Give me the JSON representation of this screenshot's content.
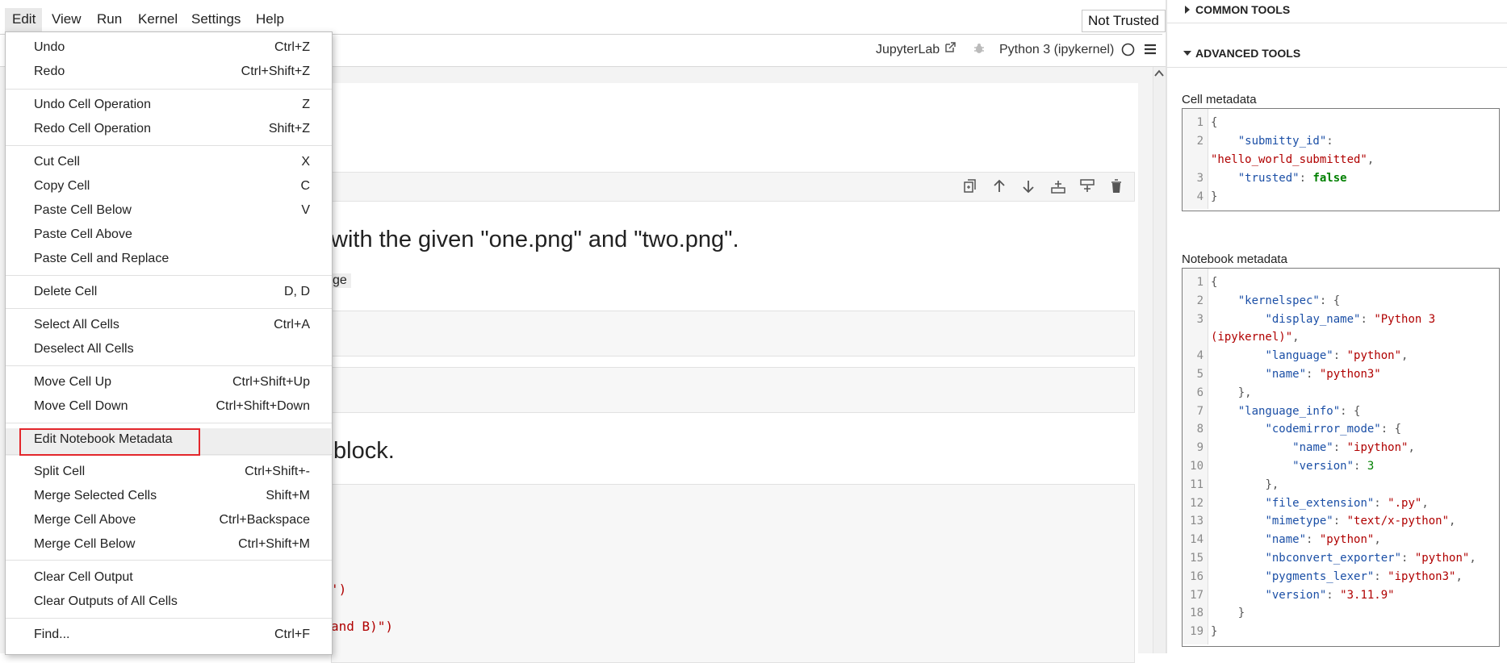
{
  "menubar": {
    "items": [
      "Edit",
      "View",
      "Run",
      "Kernel",
      "Settings",
      "Help"
    ],
    "not_trusted": "Not Trusted"
  },
  "toolbar": {
    "jupyterlab": "JupyterLab",
    "kernel": "Python 3 (ipykernel)"
  },
  "notebook": {
    "md_line1": "with the given \"one.png\" and \"two.png\".",
    "md_snippet": "ge",
    "md_line2": "block.",
    "code_frag1": "')",
    "code_frag2": "and B)\")"
  },
  "edit_menu": {
    "items": [
      {
        "label": "Undo",
        "shortcut": "Ctrl+Z"
      },
      {
        "label": "Redo",
        "shortcut": "Ctrl+Shift+Z"
      },
      {
        "label": "Undo Cell Operation",
        "shortcut": "Z"
      },
      {
        "label": "Redo Cell Operation",
        "shortcut": "Shift+Z"
      },
      {
        "label": "Cut Cell",
        "shortcut": "X"
      },
      {
        "label": "Copy Cell",
        "shortcut": "C"
      },
      {
        "label": "Paste Cell Below",
        "shortcut": "V"
      },
      {
        "label": "Paste Cell Above",
        "shortcut": ""
      },
      {
        "label": "Paste Cell and Replace",
        "shortcut": ""
      },
      {
        "label": "Delete Cell",
        "shortcut": "D, D"
      },
      {
        "label": "Select All Cells",
        "shortcut": "Ctrl+A"
      },
      {
        "label": "Deselect All Cells",
        "shortcut": ""
      },
      {
        "label": "Move Cell Up",
        "shortcut": "Ctrl+Shift+Up"
      },
      {
        "label": "Move Cell Down",
        "shortcut": "Ctrl+Shift+Down"
      },
      {
        "label": "Edit Notebook Metadata",
        "shortcut": ""
      },
      {
        "label": "Split Cell",
        "shortcut": "Ctrl+Shift+-"
      },
      {
        "label": "Merge Selected Cells",
        "shortcut": "Shift+M"
      },
      {
        "label": "Merge Cell Above",
        "shortcut": "Ctrl+Backspace"
      },
      {
        "label": "Merge Cell Below",
        "shortcut": "Ctrl+Shift+M"
      },
      {
        "label": "Clear Cell Output",
        "shortcut": ""
      },
      {
        "label": "Clear Outputs of All Cells",
        "shortcut": ""
      },
      {
        "label": "Find...",
        "shortcut": "Ctrl+F"
      }
    ]
  },
  "sidebar": {
    "common_tools": "COMMON TOOLS",
    "advanced_tools": "ADVANCED TOOLS",
    "cell_metadata_label": "Cell metadata",
    "notebook_metadata_label": "Notebook metadata",
    "cell_lines": [
      "1",
      "2",
      "3",
      "4"
    ],
    "cell_code": {
      "l1": "{",
      "l2_key": "\"submitty_id\"",
      "l2_colon": ":",
      "l2b_val": "\"hello_world_submitted\"",
      "l2b_comma": ",",
      "l3_key": "\"trusted\"",
      "l3_colon": ": ",
      "l3_val": "false",
      "l4": "}"
    },
    "nb_lines": [
      "1",
      "2",
      "3",
      "4",
      "5",
      "6",
      "7",
      "8",
      "9",
      "10",
      "11",
      "12",
      "13",
      "14",
      "15",
      "16",
      "17",
      "18",
      "19"
    ],
    "nb_code": {
      "r1": "{",
      "r2k": "\"kernelspec\"",
      "r2p": ": {",
      "r3k": "\"display_name\"",
      "r3p": ": ",
      "r3v": "\"Python 3",
      "r3b": "(ipykernel)\"",
      "r3bp": ",",
      "r4k": "\"language\"",
      "r4p": ": ",
      "r4v": "\"python\"",
      "r4c": ",",
      "r5k": "\"name\"",
      "r5p": ": ",
      "r5v": "\"python3\"",
      "r6": "},",
      "r7k": "\"language_info\"",
      "r7p": ": {",
      "r8k": "\"codemirror_mode\"",
      "r8p": ": {",
      "r9k": "\"name\"",
      "r9p": ": ",
      "r9v": "\"ipython\"",
      "r9c": ",",
      "r10k": "\"version\"",
      "r10p": ": ",
      "r10v": "3",
      "r11": "},",
      "r12k": "\"file_extension\"",
      "r12p": ": ",
      "r12v": "\".py\"",
      "r12c": ",",
      "r13k": "\"mimetype\"",
      "r13p": ": ",
      "r13v": "\"text/x-python\"",
      "r13c": ",",
      "r14k": "\"name\"",
      "r14p": ": ",
      "r14v": "\"python\"",
      "r14c": ",",
      "r15k": "\"nbconvert_exporter\"",
      "r15p": ": ",
      "r15v": "\"python\"",
      "r15c": ",",
      "r16k": "\"pygments_lexer\"",
      "r16p": ": ",
      "r16v": "\"ipython3\"",
      "r16c": ",",
      "r17k": "\"version\"",
      "r17p": ": ",
      "r17v": "\"3.11.9\"",
      "r18": "}",
      "r19": "}"
    }
  },
  "colors": {
    "highlight_border": "#e3262b",
    "json_key": "#1b4fa6",
    "json_string": "#b00000",
    "json_bool": "#008000"
  }
}
